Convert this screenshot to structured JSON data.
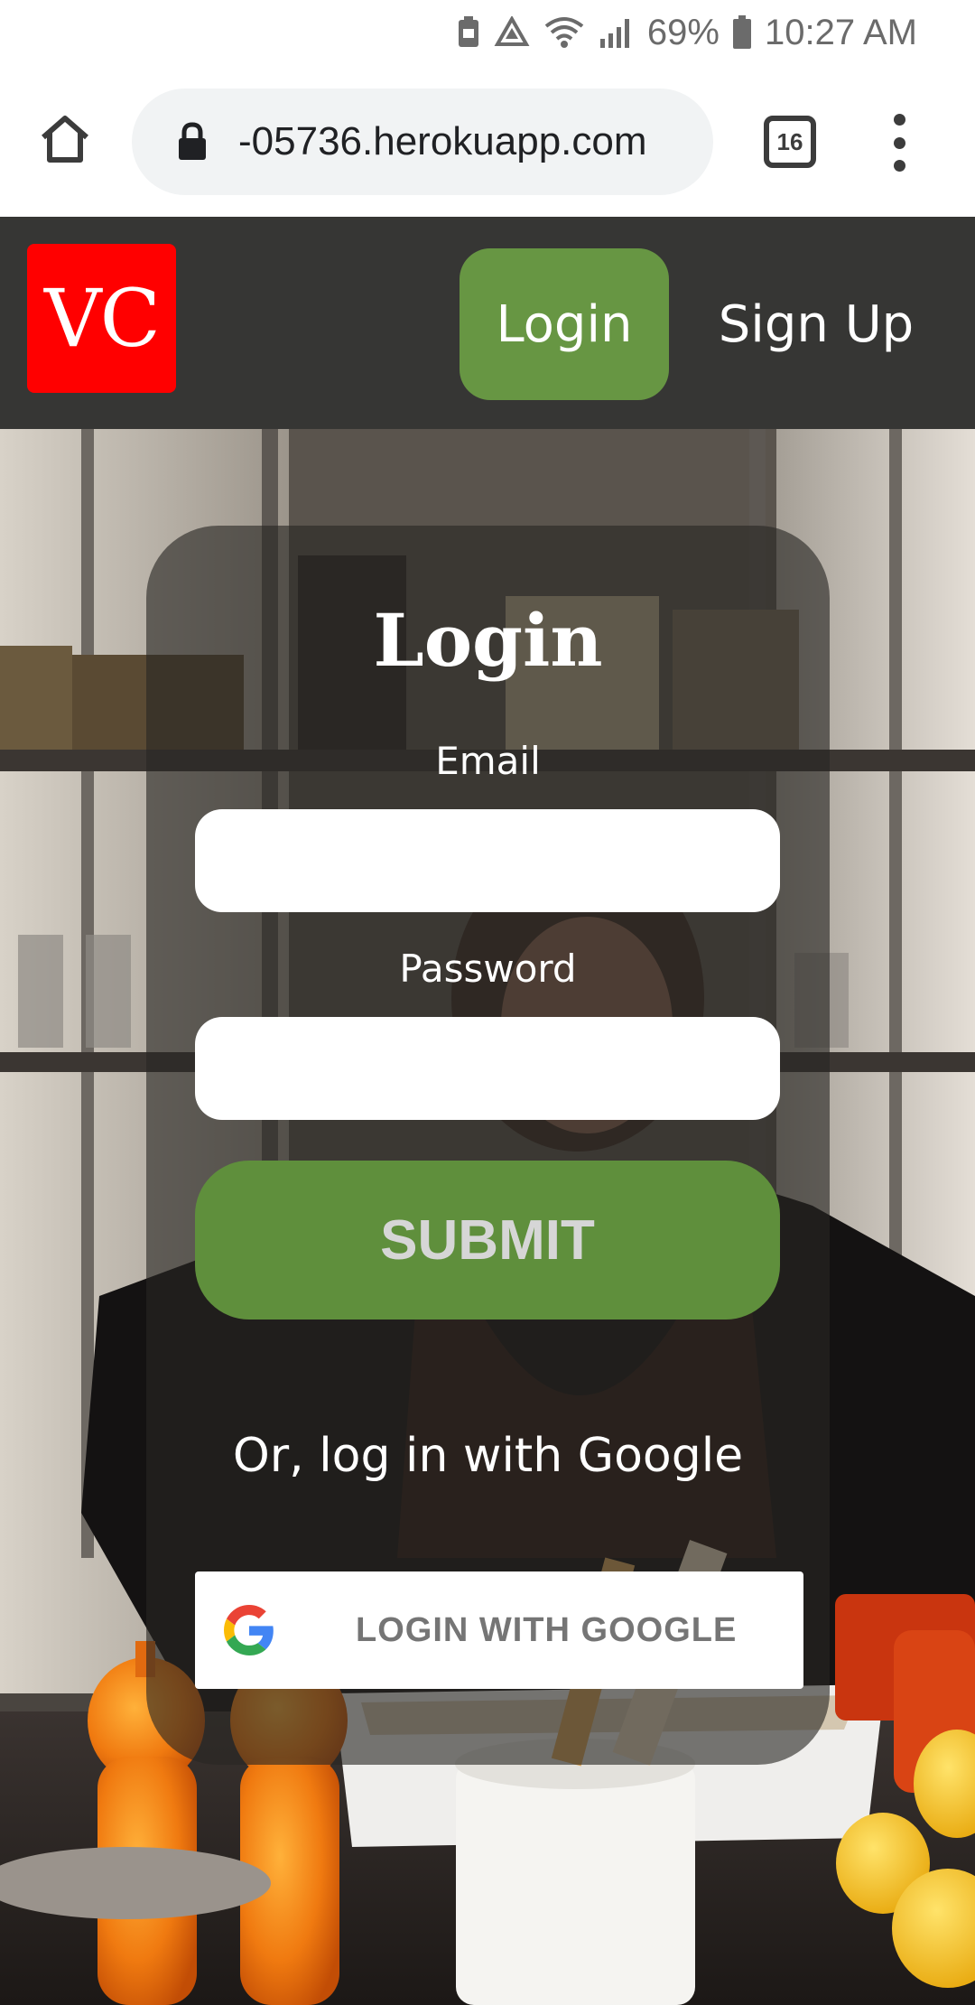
{
  "status_bar": {
    "battery": "69%",
    "time": "10:27 AM"
  },
  "browser": {
    "url": "-05736.herokuapp.com",
    "tab_count": "16"
  },
  "site_header": {
    "logo_text": "VC",
    "nav": {
      "login": "Login",
      "signup": "Sign Up"
    }
  },
  "login_form": {
    "title": "Login",
    "email_label": "Email",
    "email_value": "",
    "password_label": "Password",
    "password_value": "",
    "submit_label": "SUBMIT",
    "google_prompt": "Or, log in with Google",
    "google_button_label": "LOGIN WITH GOOGLE"
  },
  "colors": {
    "header_bg": "#363634",
    "brand_red": "#ff0000",
    "accent_green": "#679643",
    "submit_green": "#5f8f3c"
  },
  "icons": [
    "home-icon",
    "lock-icon",
    "tabs-icon",
    "more-vert-icon",
    "google-icon",
    "wifi-icon",
    "signal-icon",
    "battery-icon"
  ]
}
